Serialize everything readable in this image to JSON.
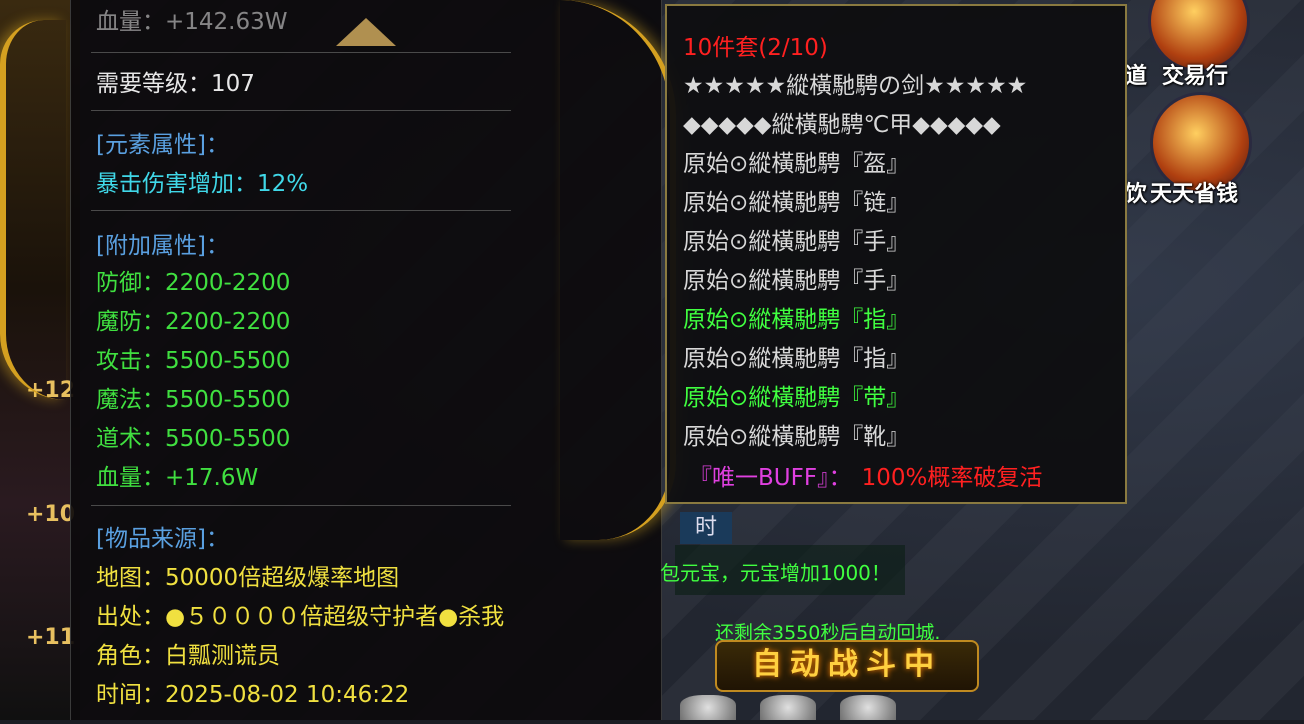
{
  "left_panel": {
    "hp_top": "血量：+142.63W",
    "level_label": "需要等级：",
    "level_value": "107",
    "element_header": "[元素属性]：",
    "crit_label": "暴击伤害增加：",
    "crit_value": "12%",
    "bonus_header": "[附加属性]：",
    "stats": [
      {
        "label": "防御：",
        "value": "2200-2200"
      },
      {
        "label": "魔防：",
        "value": "2200-2200"
      },
      {
        "label": "攻击：",
        "value": "5500-5500"
      },
      {
        "label": "魔法：",
        "value": "5500-5500"
      },
      {
        "label": "道术：",
        "value": "5500-5500"
      },
      {
        "label": "血量：",
        "value": "+17.6W"
      }
    ],
    "source_header": "[物品来源]：",
    "source": [
      {
        "label": "地图：",
        "value": "50000倍超级爆率地图"
      },
      {
        "label": "出处：",
        "value": "●５００００倍超级守护者●杀我"
      },
      {
        "label": "角色：",
        "value": "白瓢测谎员"
      },
      {
        "label": "时间：",
        "value": "2025-08-02 10:46:22"
      }
    ]
  },
  "right_panel": {
    "set_title": "10件套(2/10)",
    "weapon": "★★★★★縱橫馳騁の剑★★★★★",
    "armor": "◆◆◆◆◆縱橫馳騁℃甲◆◆◆◆◆",
    "pieces": [
      {
        "text": "原始⊙縱橫馳騁『盔』",
        "owned": false
      },
      {
        "text": "原始⊙縱橫馳騁『链』",
        "owned": false
      },
      {
        "text": "原始⊙縱橫馳騁『手』",
        "owned": false
      },
      {
        "text": "原始⊙縱橫馳騁『手』",
        "owned": false
      },
      {
        "text": "原始⊙縱橫馳騁『指』",
        "owned": true
      },
      {
        "text": "原始⊙縱橫馳騁『指』",
        "owned": false
      },
      {
        "text": "原始⊙縱橫馳騁『带』",
        "owned": true
      },
      {
        "text": "原始⊙縱橫馳騁『靴』",
        "owned": false
      }
    ],
    "buff_label": "『唯一BUFF』：",
    "buff_value": "100%概率破复活"
  },
  "icons": [
    {
      "name": "trade-icon",
      "label": "交易行"
    },
    {
      "name": "daily-save-icon",
      "label": "天天省钱"
    }
  ],
  "partial_labels": {
    "top": "道",
    "mid": "饮"
  },
  "left_strip_numbers": [
    "+12",
    "+10",
    "+11"
  ],
  "chat": {
    "time_tab": "时",
    "yuanbao_msg": "包元宝，元宝增加1000！",
    "return_msg": "还剩余3550秒后自动回城."
  },
  "auto_battle": "自动战斗中"
}
